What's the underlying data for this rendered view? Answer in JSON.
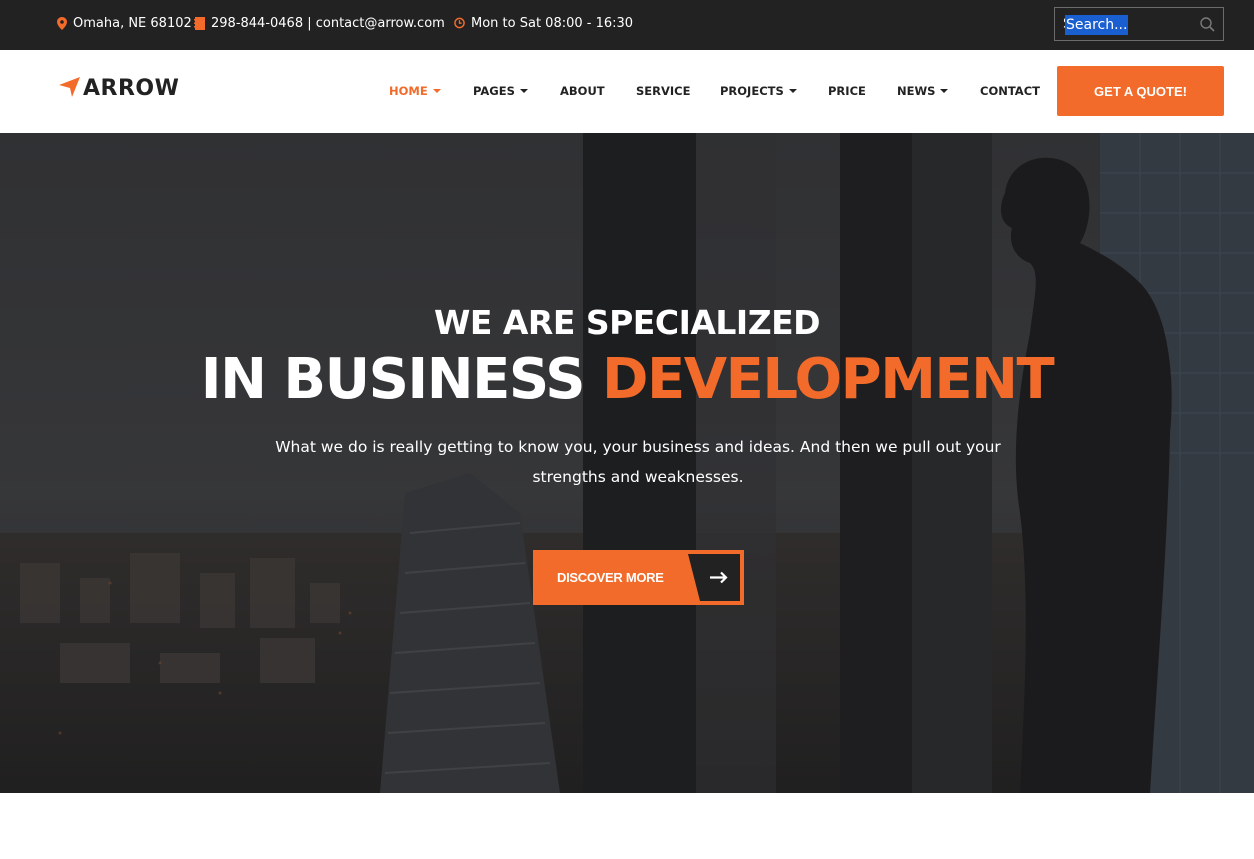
{
  "topbar": {
    "location": "Omaha, NE 68102",
    "phone_email": "298-844-0468 | contact@arrow.com",
    "hours": "Mon to Sat 08:00 - 16:30",
    "search_value": "Search...",
    "accent_color": "#f26b2a",
    "icons": [
      "map-pin-icon",
      "phone-book-icon",
      "clock-icon",
      "search-icon"
    ]
  },
  "header": {
    "logo_text": "ARROW",
    "nav": [
      {
        "label": "HOME",
        "dropdown": true,
        "active": true
      },
      {
        "label": "PAGES",
        "dropdown": true,
        "active": false
      },
      {
        "label": "ABOUT",
        "dropdown": false,
        "active": false
      },
      {
        "label": "SERVICE",
        "dropdown": false,
        "active": false
      },
      {
        "label": "PROJECTS",
        "dropdown": true,
        "active": false
      },
      {
        "label": "PRICE",
        "dropdown": false,
        "active": false
      },
      {
        "label": "NEWS",
        "dropdown": true,
        "active": false
      },
      {
        "label": "CONTACT",
        "dropdown": false,
        "active": false
      }
    ],
    "quote_label": "GET A QUOTE!"
  },
  "hero": {
    "subtitle": "WE ARE SPECIALIZED",
    "title_white": "IN BUSINESS",
    "title_accent": "DEVELOPMENT",
    "description": "What we do is really getting to know you, your business and ideas. And then we pull out your strengths and weaknesses.",
    "button_label": "DISCOVER MORE"
  },
  "colors": {
    "accent": "#f26b2a",
    "topbar_bg": "#222222",
    "hero_overlay": "#2a2b2d"
  }
}
